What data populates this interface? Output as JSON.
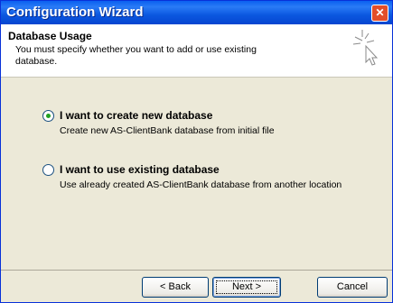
{
  "window": {
    "title": "Configuration Wizard",
    "close_glyph": "✕"
  },
  "header": {
    "title": "Database Usage",
    "description": "You must specify whether you want to add or use existing database.",
    "icon": "wizard-wand-icon"
  },
  "options": [
    {
      "label": "I want to create new database",
      "description": "Create new AS-ClientBank database from initial file",
      "checked": true
    },
    {
      "label": "I want to use existing database",
      "description": "Use already created AS-ClientBank database from another location",
      "checked": false
    }
  ],
  "buttons": {
    "back": "< Back",
    "next": "Next >",
    "cancel": "Cancel"
  },
  "colors": {
    "title_bar": "#0a5ff0",
    "dialog_bg": "#ece9d8",
    "radio_dot": "#21a121"
  }
}
